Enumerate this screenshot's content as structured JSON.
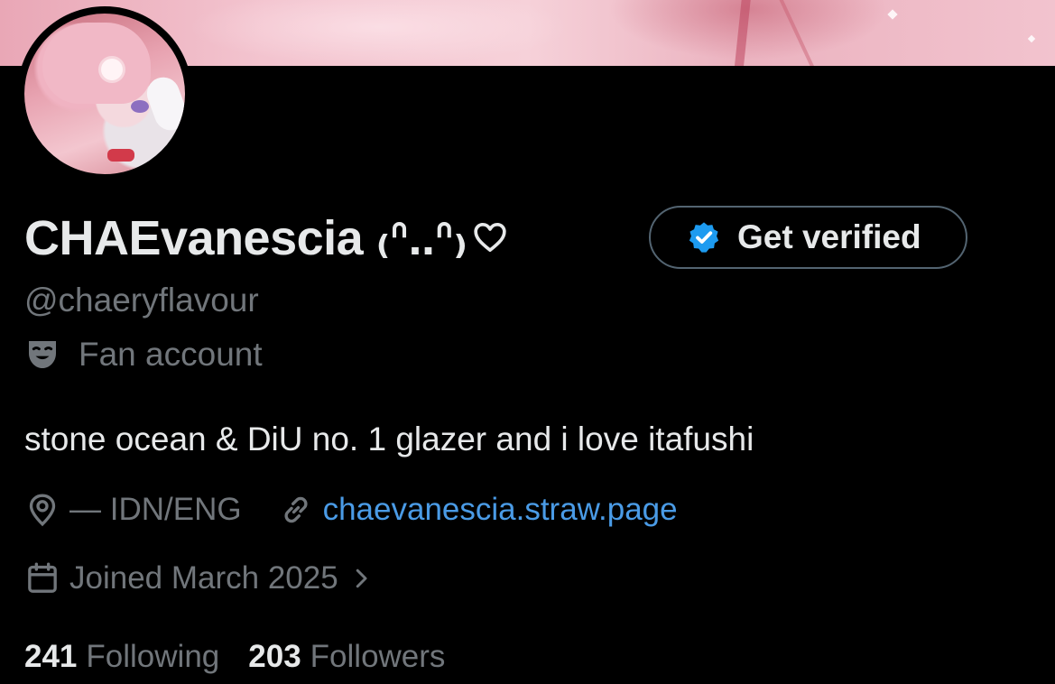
{
  "profile": {
    "display_name": "CHAEvanescia ₍ᐢ..ᐢ₎",
    "handle": "@chaeryflavour",
    "category": "Fan account",
    "bio": "stone ocean & DiU no. 1 glazer and i love itafushi",
    "location": "— IDN/ENG",
    "website": "chaevanescia.straw.page",
    "joined": "Joined March 2025",
    "following_count": "241",
    "following_label": "Following",
    "followers_count": "203",
    "followers_label": "Followers"
  },
  "actions": {
    "get_verified_label": "Get verified"
  },
  "icons": {
    "heart": "heart-outline-icon",
    "badge": "verified-badge-icon",
    "category": "theater-mask-icon",
    "location": "location-pin-icon",
    "link": "link-icon",
    "calendar": "calendar-icon",
    "chevron": "chevron-right-icon"
  },
  "colors": {
    "background": "#000000",
    "text_primary": "#e7e9ea",
    "text_secondary": "#71767b",
    "link": "#4a9be6",
    "verified_blue": "#1d9bf0",
    "button_border": "#536471",
    "banner_pink": "#f3c4cf"
  }
}
